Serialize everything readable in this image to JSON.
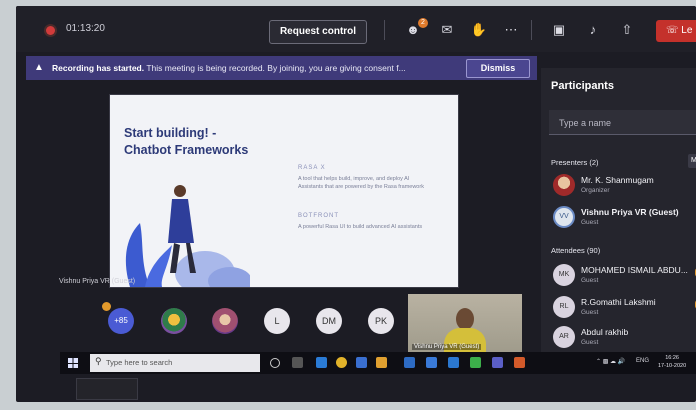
{
  "topbar": {
    "timer": "01:13:20",
    "request_control_label": "Request control",
    "participants_badge": "2",
    "leave_label": "Le"
  },
  "banner": {
    "title": "Recording has started.",
    "message": "This meeting is being recorded. By joining, you are giving consent f...",
    "dismiss_label": "Dismiss"
  },
  "slide": {
    "title_line1": "Start building! -",
    "title_line2": "Chatbot Frameworks",
    "subhead1": "RASA X",
    "para1": "A tool that helps build, improve, and deploy AI Assistants that are powered by the Rasa framework",
    "subhead2": "BOTFRONT",
    "para2": "A powerful Rasa UI to build advanced AI assistants"
  },
  "presenter_caption": "Vishnu Priya VR (Guest)",
  "avatars_row": {
    "more_label": "+85",
    "items": [
      "L",
      "DM",
      "PK"
    ]
  },
  "video_caption": "Vishnu Priya VR (Guest)",
  "panel": {
    "title": "Participants",
    "search_placeholder": "Type a name",
    "presenters_label": "Presenters (2)",
    "mute_all_label": "Mu",
    "presenters": [
      {
        "name": "Mr. K. Shanmugam",
        "role": "Organizer",
        "initials": ""
      },
      {
        "name": "Vishnu Priya VR (Guest)",
        "role": "Guest",
        "initials": "VV"
      }
    ],
    "attendees_label": "Attendees (90)",
    "attendees": [
      {
        "name": "MOHAMED ISMAIL ABDU...",
        "role": "Guest",
        "initials": "MK"
      },
      {
        "name": "R.Gomathi Lakshmi",
        "role": "Guest",
        "initials": "RL"
      },
      {
        "name": "Abdul rakhib",
        "role": "Guest",
        "initials": "AR"
      }
    ]
  },
  "taskbar": {
    "search_placeholder": "Type here to search",
    "tray_text": "ENG",
    "time": "16:26",
    "date": "17-10-2020"
  },
  "colors": {
    "banner_bg": "#3f3a7a",
    "leave_red": "#c4312b",
    "slide_title": "#2d3a78",
    "hand_raise": "#e0962a"
  }
}
